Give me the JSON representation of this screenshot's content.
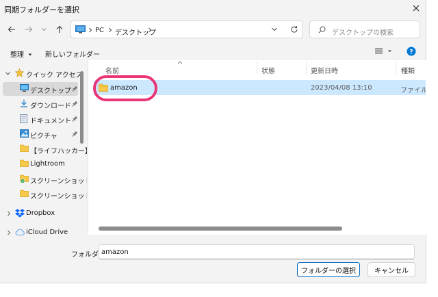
{
  "window": {
    "title": "同期フォルダーを選択"
  },
  "nav": {
    "breadcrumb": [
      "PC",
      "デスクトップ"
    ],
    "search_placeholder": "デスクトップの検索"
  },
  "toolbar": {
    "organize": "整理",
    "new_folder": "新しいフォルダー"
  },
  "sidebar": {
    "quick_access": "クイック アクセス",
    "items": [
      {
        "label": "デスクトップ",
        "icon": "desktop-icon",
        "pinned": true
      },
      {
        "label": "ダウンロード",
        "icon": "download-icon",
        "pinned": true
      },
      {
        "label": "ドキュメント",
        "icon": "document-icon",
        "pinned": true
      },
      {
        "label": "ピクチャ",
        "icon": "picture-icon",
        "pinned": true
      },
      {
        "label": "【ライフハッカー】ラン",
        "icon": "folder-icon"
      },
      {
        "label": "Lightroom",
        "icon": "folder-icon"
      },
      {
        "label": "スクリーンショット",
        "icon": "folder-sync-icon"
      },
      {
        "label": "スクリーンショット",
        "icon": "folder-icon"
      }
    ],
    "dropbox": "Dropbox",
    "icloud": "iCloud Drive"
  },
  "files": {
    "columns": [
      "名前",
      "状態",
      "更新日時",
      "種類"
    ],
    "rows": [
      {
        "name": "amazon",
        "status": "",
        "modified": "2023/04/08 13:10",
        "type": "ファイル フ"
      }
    ]
  },
  "footer": {
    "folder_label": "フォルダー:",
    "folder_value": "amazon",
    "select_button": "フォルダーの選択",
    "cancel_button": "キャンセル"
  },
  "colors": {
    "accent": "#0067c0",
    "selection": "#cce8ff",
    "highlight_ring": "#ea3577",
    "help_blue": "#0078d4"
  }
}
